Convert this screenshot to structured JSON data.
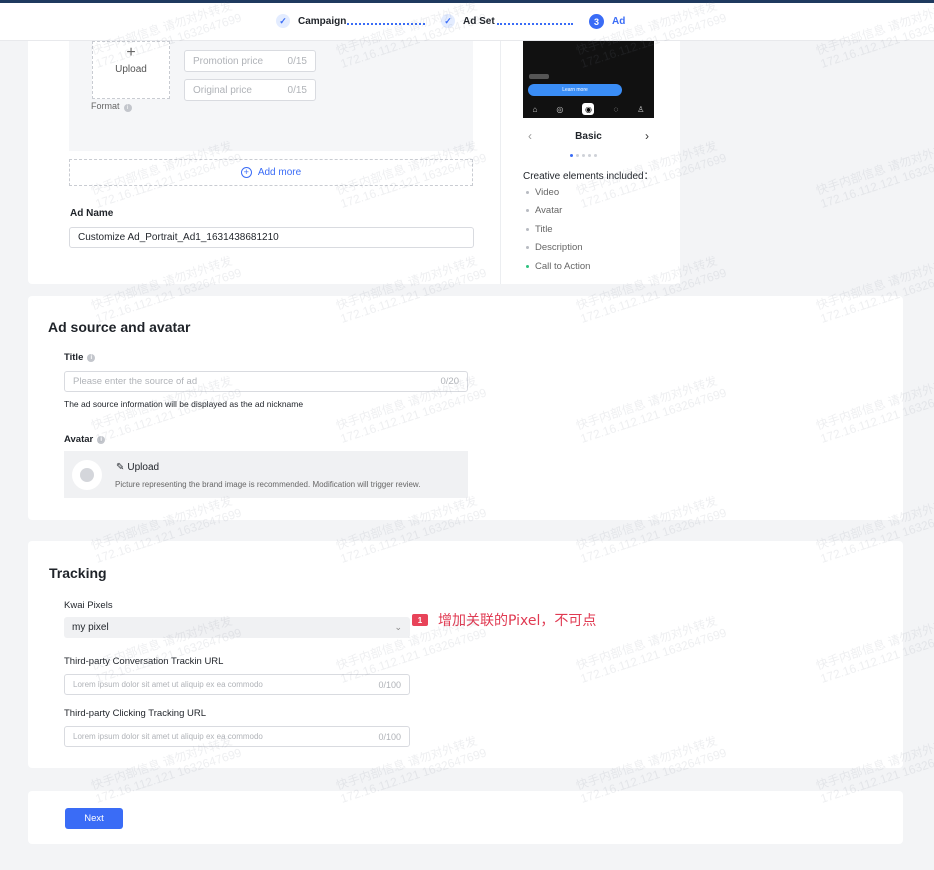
{
  "steps": [
    {
      "label": "Campaign",
      "state": "done"
    },
    {
      "label": "Ad Set",
      "state": "done"
    },
    {
      "label": "Ad",
      "state": "active",
      "number": "3"
    }
  ],
  "creative": {
    "upload_label": "Upload",
    "promotion_price": {
      "placeholder": "Promotion price",
      "count": "0/15"
    },
    "original_price": {
      "placeholder": "Original price",
      "count": "0/15"
    },
    "format_label": "Format",
    "add_more": "Add more",
    "ad_name_label": "Ad Name",
    "ad_name_value": "Customize Ad_Portrait_Ad1_1631438681210"
  },
  "preview": {
    "cta_button": "Learn more",
    "template_name": "Basic",
    "pager": {
      "count": 5,
      "active": 1
    },
    "included_title": "Creative elements included：",
    "included": [
      {
        "label": "Video",
        "active": false
      },
      {
        "label": "Avatar",
        "active": false
      },
      {
        "label": "Title",
        "active": false
      },
      {
        "label": "Description",
        "active": false
      },
      {
        "label": "Call to Action",
        "active": true
      }
    ]
  },
  "source": {
    "heading": "Ad source and avatar",
    "title_label": "Title",
    "title_placeholder": "Please enter the source of ad",
    "title_count": "0/20",
    "title_hint": "The ad source information will be displayed as the ad nickname",
    "avatar_label": "Avatar",
    "avatar_upload": "Upload",
    "avatar_desc": "Picture representing the brand image is recommended. Modification will trigger review."
  },
  "tracking": {
    "heading": "Tracking",
    "pixels_label": "Kwai Pixels",
    "pixels_value": "my pixel",
    "conv_label": "Third-party Conversation Trackin URL",
    "conv_placeholder": "Lorem ipsum dolor sit amet ut aliquip ex ea commodo",
    "conv_count": "0/100",
    "click_label": "Third-party Clicking Tracking URL",
    "click_placeholder": "Lorem ipsum dolor sit amet ut aliquip ex ea commodo",
    "click_count": "0/100"
  },
  "annotation": {
    "badge": "1",
    "text": "增加关联的Pixel，不可点"
  },
  "footer": {
    "next_label": "Next"
  },
  "watermark": {
    "line1": "快手内部信息 请勿对外转发",
    "line2": "172.16.112.121 1632647699"
  },
  "colors": {
    "accent": "#3a6cf6",
    "annotation": "#e84359",
    "success": "#2ec27e"
  }
}
